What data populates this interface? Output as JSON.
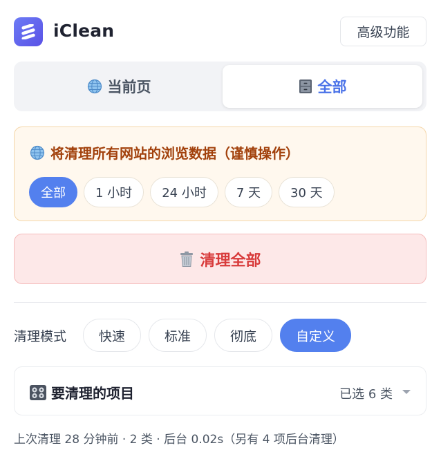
{
  "header": {
    "app_title": "iClean",
    "advanced_label": "高级功能"
  },
  "scope": {
    "current_label": "当前页",
    "all_label": "全部",
    "selected": "all"
  },
  "warning": {
    "text": "将清理所有网站的浏览数据（谨慎操作）",
    "ranges": [
      "全部",
      "1 小时",
      "24 小时",
      "7 天",
      "30 天"
    ],
    "selected_range": "全部"
  },
  "clean_button": {
    "label": "清理全部"
  },
  "mode": {
    "label": "清理模式",
    "options": [
      "快速",
      "标准",
      "彻底",
      "自定义"
    ],
    "selected": "自定义"
  },
  "items": {
    "title": "要清理的项目",
    "count": "已选 6 类"
  },
  "footer": {
    "status": "上次清理 28 分钟前 · 2 类 · 后台 0.02s（另有 4 项后台清理）"
  },
  "colors": {
    "accent": "#5380ee",
    "logo": "#5a52e6",
    "warning_bg": "#fff8ee",
    "warning_text": "#a2410c",
    "danger_bg": "#fde8e8",
    "danger_text": "#d83b3b"
  },
  "icons": {
    "logo": "broom-logo-icon",
    "current": "globe-icon",
    "all": "file-cabinet-icon",
    "warning": "globe-icon",
    "clean": "trash-can-icon",
    "items": "control-knobs-icon",
    "dropdown": "caret-down-icon"
  }
}
